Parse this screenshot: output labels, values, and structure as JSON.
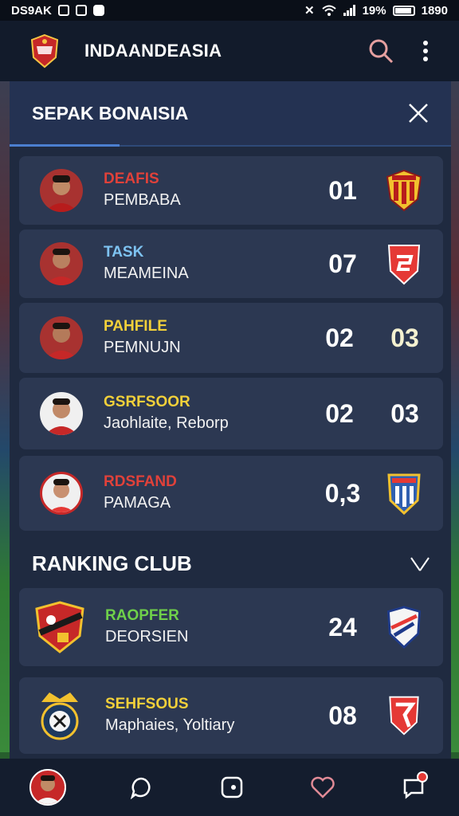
{
  "status_bar": {
    "left_text": "DS9AK",
    "battery": "19%",
    "time": "1890"
  },
  "app_bar": {
    "title": "INDAANDEASIA"
  },
  "panel": {
    "title": "SEPAK BONAISIA"
  },
  "matches": [
    {
      "name": "DEAFIS",
      "name_color": "#e0413a",
      "sub": "PEMBABA",
      "score1": "01",
      "score2": "",
      "badge": "yellow-red-crest"
    },
    {
      "name": "TASK",
      "name_color": "#7ec3f2",
      "sub": "MEAMEINA",
      "score1": "07",
      "score2": "",
      "badge": "red-shield"
    },
    {
      "name": "PAHFILE",
      "name_color": "#f2d03a",
      "sub": "PEMNUJN",
      "score1": "02",
      "score2": "03",
      "badge": ""
    },
    {
      "name": "GSRFSOOR",
      "name_color": "#f2d03a",
      "sub": "Jaohlaite, Reborp",
      "score1": "02",
      "score2": "03",
      "badge": ""
    },
    {
      "name": "RDSFAND",
      "name_color": "#e0413a",
      "sub": "PAMAGA",
      "score1": "0,3",
      "score2": "",
      "badge": "blue-yellow-shield"
    }
  ],
  "ranking": {
    "title": "RANKING CLUB",
    "items": [
      {
        "name": "RAOPFER",
        "name_color": "#6fd04a",
        "sub": "DEORSIEN",
        "score": "24",
        "badge": "blue-red-shield"
      },
      {
        "name": "SEHFSOUS",
        "name_color": "#f2d03a",
        "sub": "Maphaies, Yoltiary",
        "score": "08",
        "badge": "red-white-shield"
      }
    ]
  },
  "colors": {
    "accent": "#4b7fd0",
    "search_icon": "#e6a0a0",
    "heart_icon": "#e08a96",
    "notification": "#e53935"
  }
}
